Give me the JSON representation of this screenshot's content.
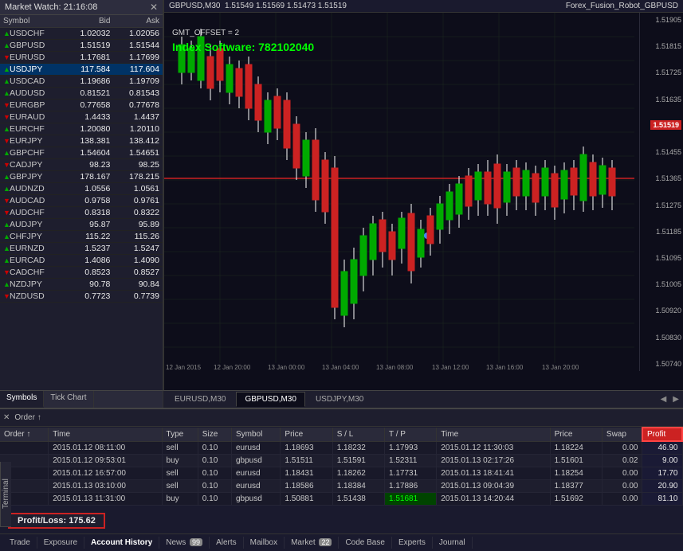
{
  "marketwatch": {
    "title": "Market Watch",
    "time": "21:16:08",
    "columns": [
      "Symbol",
      "Bid",
      "Ask"
    ],
    "rows": [
      {
        "symbol": "USDCHF",
        "dir": "up",
        "bid": "1.02032",
        "ask": "1.02056"
      },
      {
        "symbol": "GBPUSD",
        "dir": "up",
        "bid": "1.51519",
        "ask": "1.51544"
      },
      {
        "symbol": "EURUSD",
        "dir": "down",
        "bid": "1.17681",
        "ask": "1.17699"
      },
      {
        "symbol": "USDJPY",
        "dir": "up",
        "bid": "117.584",
        "ask": "117.604",
        "selected": true
      },
      {
        "symbol": "USDCAD",
        "dir": "up",
        "bid": "1.19686",
        "ask": "1.19709"
      },
      {
        "symbol": "AUDUSD",
        "dir": "up",
        "bid": "0.81521",
        "ask": "0.81543"
      },
      {
        "symbol": "EURGBP",
        "dir": "down",
        "bid": "0.77658",
        "ask": "0.77678"
      },
      {
        "symbol": "EURAUD",
        "dir": "down",
        "bid": "1.4433",
        "ask": "1.4437"
      },
      {
        "symbol": "EURCHF",
        "dir": "up",
        "bid": "1.20080",
        "ask": "1.20110"
      },
      {
        "symbol": "EURJPY",
        "dir": "down",
        "bid": "138.381",
        "ask": "138.412"
      },
      {
        "symbol": "GBPCHF",
        "dir": "up",
        "bid": "1.54604",
        "ask": "1.54651"
      },
      {
        "symbol": "CADJPY",
        "dir": "down",
        "bid": "98.23",
        "ask": "98.25"
      },
      {
        "symbol": "GBPJPY",
        "dir": "up",
        "bid": "178.167",
        "ask": "178.215"
      },
      {
        "symbol": "AUDNZD",
        "dir": "up",
        "bid": "1.0556",
        "ask": "1.0561"
      },
      {
        "symbol": "AUDCAD",
        "dir": "down",
        "bid": "0.9758",
        "ask": "0.9761"
      },
      {
        "symbol": "AUDCHF",
        "dir": "down",
        "bid": "0.8318",
        "ask": "0.8322"
      },
      {
        "symbol": "AUDJPY",
        "dir": "up",
        "bid": "95.87",
        "ask": "95.89"
      },
      {
        "symbol": "CHFJPY",
        "dir": "up",
        "bid": "115.22",
        "ask": "115.26"
      },
      {
        "symbol": "EURNZD",
        "dir": "up",
        "bid": "1.5237",
        "ask": "1.5247"
      },
      {
        "symbol": "EURCAD",
        "dir": "up",
        "bid": "1.4086",
        "ask": "1.4090"
      },
      {
        "symbol": "CADCHF",
        "dir": "down",
        "bid": "0.8523",
        "ask": "0.8527"
      },
      {
        "symbol": "NZDJPY",
        "dir": "up",
        "bid": "90.78",
        "ask": "90.84"
      },
      {
        "symbol": "NZDUSD",
        "dir": "down",
        "bid": "0.7723",
        "ask": "0.7739"
      }
    ],
    "tabs": [
      "Symbols",
      "Tick Chart"
    ]
  },
  "chart": {
    "symbol": "GBPUSD,M30",
    "prices": "1.51549  1.51569  1.51473  1.51519",
    "robot": "Forex_Fusion_Robot_GBPUSD",
    "indicator_label": "Index Software: 782102040",
    "gmt": "GMT_OFFSET = 2",
    "price_levels": [
      "1.51905",
      "1.51815",
      "1.51725",
      "1.51635",
      "1.51545",
      "1.51455",
      "1.51365",
      "1.51275",
      "1.51185",
      "1.51095",
      "1.51005",
      "1.50920",
      "1.50830",
      "1.50740"
    ],
    "current_price": "1.51519",
    "time_labels": [
      "12 Jan 2015",
      "12 Jan 20:00",
      "13 Jan 00:00",
      "13 Jan 04:00",
      "13 Jan 08:00",
      "13 Jan 12:00",
      "13 Jan 16:00",
      "13 Jan 20:00"
    ],
    "tabs": [
      "EURUSD,M30",
      "GBPUSD,M30",
      "USDJPY,M30"
    ],
    "active_tab": "GBPUSD,M30"
  },
  "terminal": {
    "label": "Terminal",
    "order_columns": [
      "Order",
      "Time",
      "Type",
      "Size",
      "Symbol",
      "Price",
      "S / L",
      "T / P",
      "Time",
      "Price",
      "Swap",
      "Profit"
    ],
    "orders": [
      {
        "order": "",
        "open_time": "2015.01.12 08:11:00",
        "type": "sell",
        "size": "0.10",
        "symbol": "eurusd",
        "price": "1.18693",
        "sl": "1.18232",
        "tp": "1.17993",
        "close_time": "2015.01.12 11:30:03",
        "close_price": "1.18224",
        "swap": "0.00",
        "profit": "46.90"
      },
      {
        "order": "",
        "open_time": "2015.01.12 09:53:01",
        "type": "buy",
        "size": "0.10",
        "symbol": "gbpusd",
        "price": "1.51511",
        "sl": "1.51591",
        "tp": "1.52311",
        "close_time": "2015.01.13 02:17:26",
        "close_price": "1.51601",
        "swap": "0.02",
        "profit": "9.00"
      },
      {
        "order": "",
        "open_time": "2015.01.12 16:57:00",
        "type": "sell",
        "size": "0.10",
        "symbol": "eurusd",
        "price": "1.18431",
        "sl": "1.18262",
        "tp": "1.17731",
        "close_time": "2015.01.13 18:41:41",
        "close_price": "1.18254",
        "swap": "0.00",
        "profit": "17.70"
      },
      {
        "order": "",
        "open_time": "2015.01.13 03:10:00",
        "type": "sell",
        "size": "0.10",
        "symbol": "eurusd",
        "price": "1.18586",
        "sl": "1.18384",
        "tp": "1.17886",
        "close_time": "2015.01.13 09:04:39",
        "close_price": "1.18377",
        "swap": "0.00",
        "profit": "20.90"
      },
      {
        "order": "",
        "open_time": "2015.01.13 11:31:00",
        "type": "buy",
        "size": "0.10",
        "symbol": "gbpusd",
        "price": "1.50881",
        "sl": "1.51438",
        "tp": "1.51681",
        "close_time": "2015.01.13 14:20:44",
        "close_price": "1.51692",
        "swap": "0.00",
        "profit": "81.10",
        "tp_highlight": true
      }
    ],
    "profit_loss_label": "Profit/Loss:",
    "profit_loss_value": "175.62"
  },
  "bottom_tabs": {
    "items": [
      {
        "label": "Trade",
        "badge": null,
        "active": false
      },
      {
        "label": "Exposure",
        "badge": null,
        "active": false
      },
      {
        "label": "Account History",
        "badge": null,
        "active": true
      },
      {
        "label": "News",
        "badge": "99",
        "active": false
      },
      {
        "label": "Alerts",
        "badge": null,
        "active": false
      },
      {
        "label": "Mailbox",
        "badge": null,
        "active": false
      },
      {
        "label": "Market",
        "badge": "22",
        "active": false
      },
      {
        "label": "Code Base",
        "badge": null,
        "active": false
      },
      {
        "label": "Experts",
        "badge": null,
        "active": false
      },
      {
        "label": "Journal",
        "badge": null,
        "active": false
      }
    ]
  }
}
